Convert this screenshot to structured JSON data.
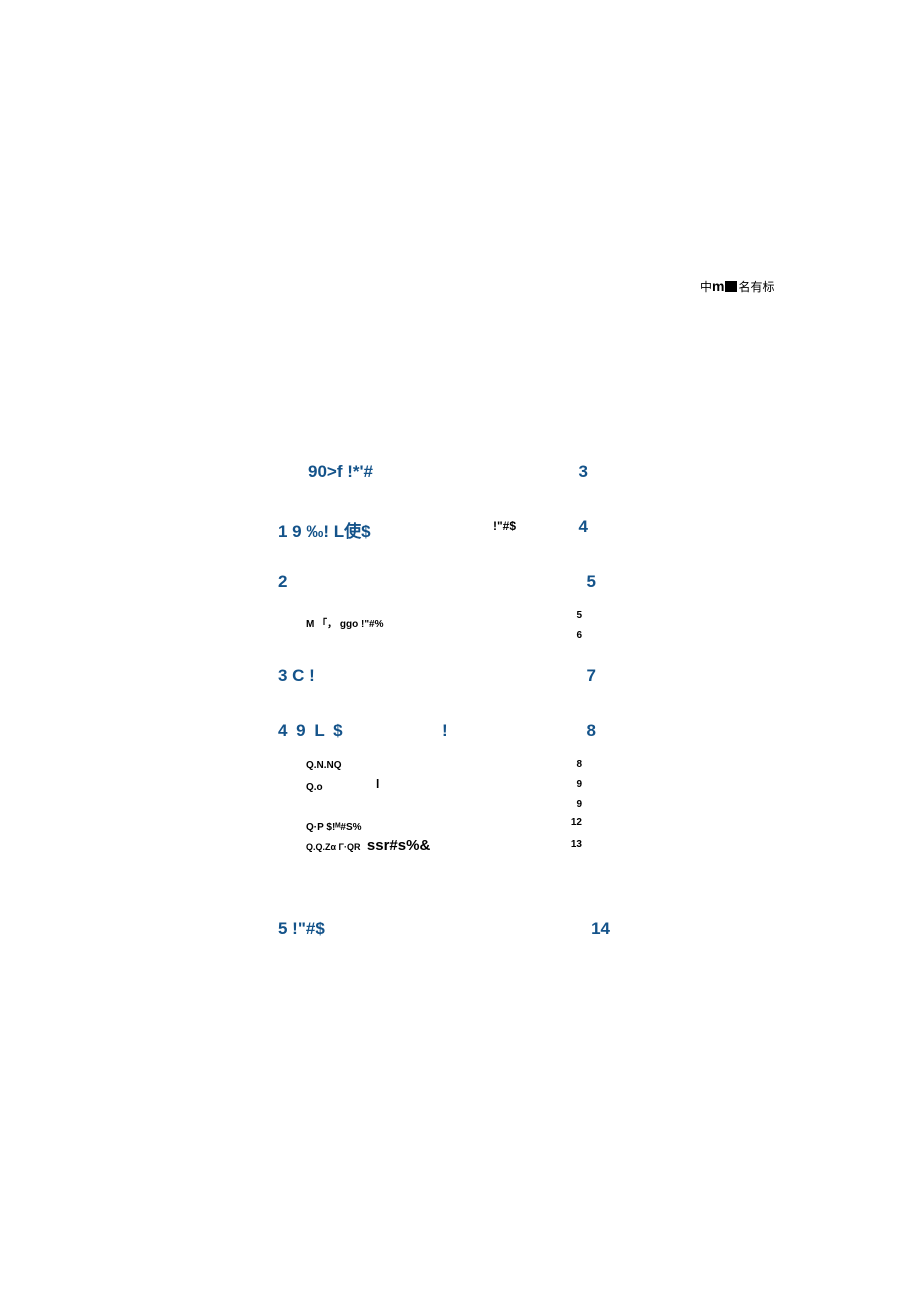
{
  "header_mark": {
    "left": "中",
    "m": "m",
    "right": "名有标"
  },
  "toc": {
    "row_top": {
      "label": "90>f !*'#",
      "page": "3"
    },
    "row_1": {
      "label": "1 9 ‰! L使$",
      "mid": "!\"#$",
      "page": "4"
    },
    "row_2": {
      "label": "2",
      "page": "5"
    },
    "row_2_sub": [
      {
        "label": "M 「， ggo !\"#%",
        "page": "5"
      },
      {
        "label": "",
        "page": "6"
      }
    ],
    "row_3": {
      "label": "3 C !",
      "page": "7"
    },
    "row_4": {
      "label": "4 9 L $",
      "mid": "!",
      "page": "8"
    },
    "row_4_sub": [
      {
        "label": "Q.N.NQ",
        "page": "8"
      },
      {
        "label": "Q.o",
        "mid": "l",
        "page": "9"
      },
      {
        "label": "",
        "page": "9"
      },
      {
        "label": "Q·P $!ᴹ#S%",
        "page": "12"
      },
      {
        "label": "Q.Q.Zα Γ·QR",
        "ssr": "ssr#s%&",
        "page": "13"
      }
    ],
    "row_5": {
      "label": "5 !\"#$",
      "page": "14"
    }
  }
}
